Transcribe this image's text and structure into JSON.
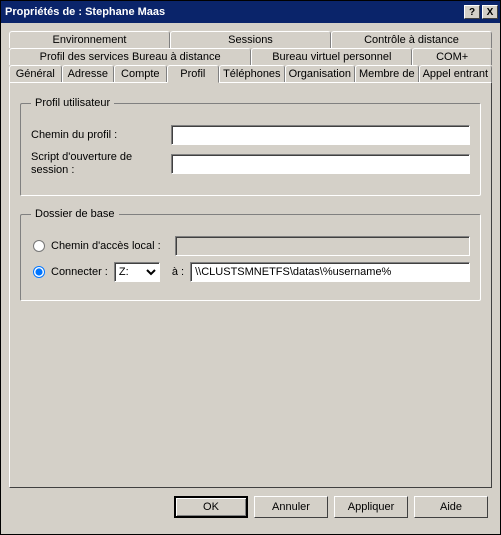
{
  "title": "Propriétés de : Stephane Maas",
  "title_buttons": {
    "help": "?",
    "close": "X"
  },
  "tabs": {
    "row1": [
      "Environnement",
      "Sessions",
      "Contrôle à distance"
    ],
    "row2": [
      "Profil des services Bureau à distance",
      "Bureau virtuel personnel",
      "COM+"
    ],
    "row3": [
      "Général",
      "Adresse",
      "Compte",
      "Profil",
      "Téléphones",
      "Organisation",
      "Membre de",
      "Appel entrant"
    ]
  },
  "active_tab": "Profil",
  "profile_group": {
    "legend": "Profil utilisateur",
    "path_label": "Chemin du profil :",
    "path_value": "",
    "script_label": "Script d'ouverture de session :",
    "script_value": ""
  },
  "home_group": {
    "legend": "Dossier de base",
    "local_label": "Chemin d'accès local :",
    "local_value": "",
    "connect_label": "Connecter :",
    "drive": "Z:",
    "to_label": "à :",
    "unc": "\\\\CLUSTSMNETFS\\datas\\%username%",
    "selected": "connect"
  },
  "buttons": {
    "ok": "OK",
    "cancel": "Annuler",
    "apply": "Appliquer",
    "help": "Aide"
  }
}
